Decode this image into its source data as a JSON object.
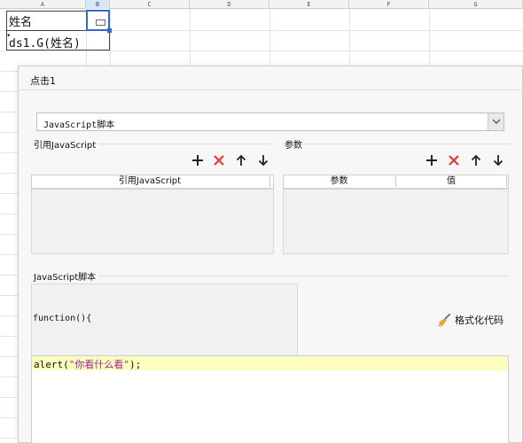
{
  "spreadsheet": {
    "columns": [
      "A",
      "B",
      "C",
      "D",
      "E",
      "F",
      "G"
    ],
    "active_column": "B",
    "cell_a1": "姓名",
    "cell_a2": "ds1.G(姓名)"
  },
  "dialog": {
    "title": "点击1",
    "script_type_selected": "JavaScript脚本",
    "ref_section": {
      "label": "引用JavaScript",
      "column_header": "引用JavaScript"
    },
    "param_section": {
      "label": "参数",
      "column_headers": [
        "参数",
        "值"
      ]
    },
    "toolbar": {
      "add": "add-icon",
      "delete": "delete-icon",
      "up": "arrow-up-icon",
      "down": "arrow-down-icon"
    },
    "script_section": {
      "label": "JavaScript脚本",
      "function_header": "function(){",
      "format_button": "格式化代码",
      "code_prefix": "alert(",
      "code_string": "\"你看什么看\"",
      "code_suffix": ");"
    },
    "colors": {
      "delete_red": "#e53935",
      "selection_blue": "#2f6dc9",
      "highlight_line": "#fdfdbf",
      "string_color": "#a0299a"
    }
  }
}
